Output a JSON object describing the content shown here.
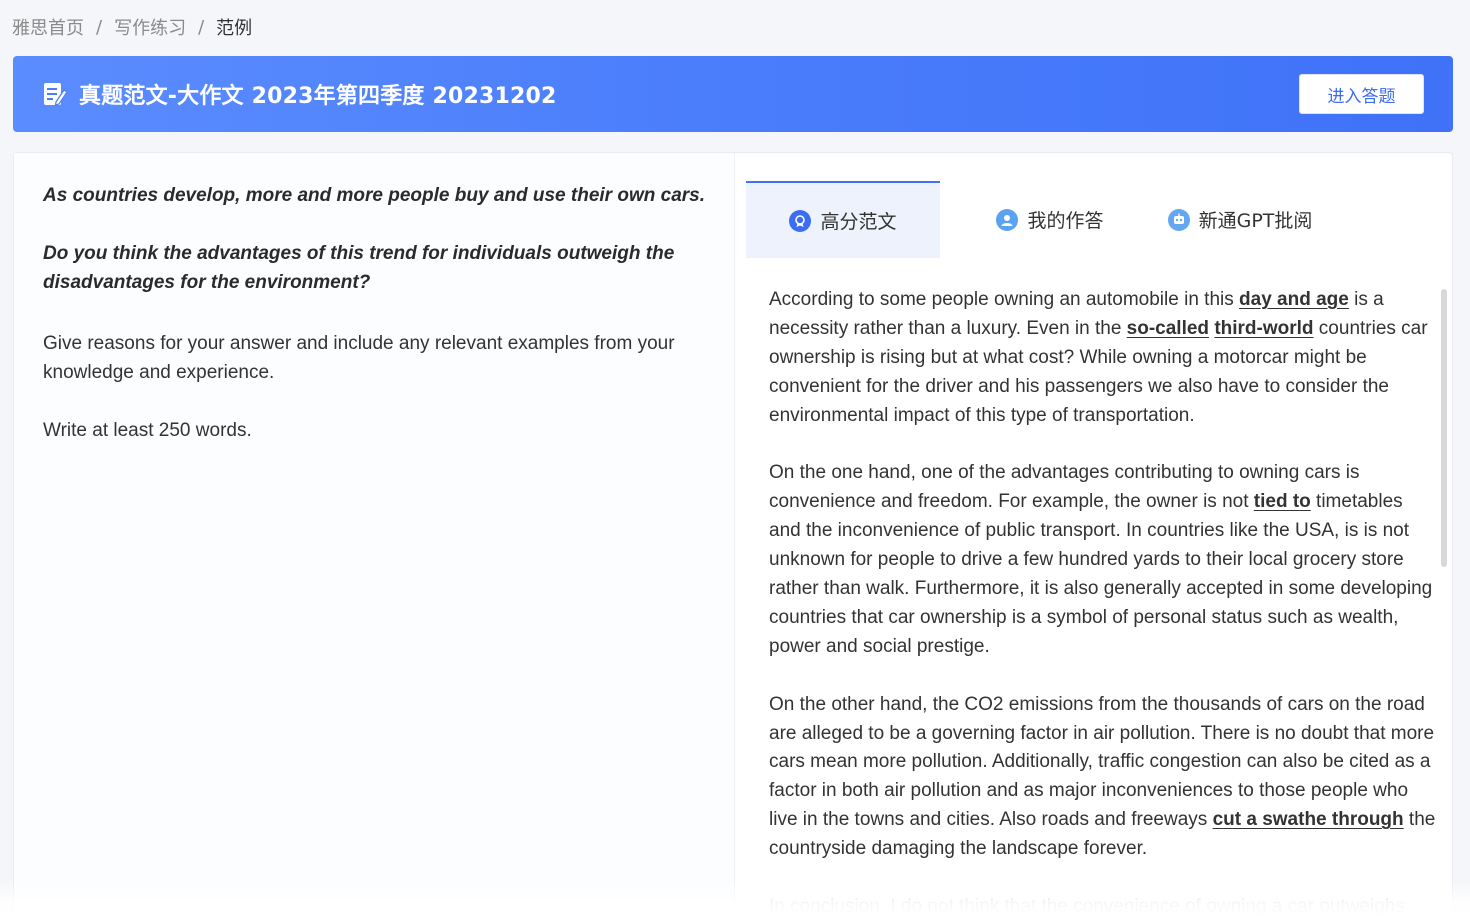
{
  "breadcrumb": {
    "items": [
      "雅思首页",
      "写作练习",
      "范例"
    ],
    "separator": "/"
  },
  "banner": {
    "icon": "edit-document-icon",
    "title": "真题范文-大作文 2023年第四季度 20231202",
    "enter_button": "进入答题"
  },
  "question": {
    "line1": "As countries develop, more and more people buy and use their own cars.",
    "line2": "Do you think the advantages of this trend for individuals outweigh the disadvantages for the environment?",
    "line3": "Give reasons for your answer and include any relevant examples from your knowledge and experience.",
    "line4": "Write at least 250 words."
  },
  "tabs": [
    {
      "label": "高分范文",
      "icon": "award-badge-icon",
      "active": true
    },
    {
      "label": "我的作答",
      "icon": "user-icon",
      "active": false
    },
    {
      "label": "新通GPT批阅",
      "icon": "robot-icon",
      "active": false
    }
  ],
  "essay": {
    "p1": {
      "a": "According to some people owning an automobile in this ",
      "u1": "day and age",
      "b": " is a necessity rather than a luxury. Even in the ",
      "u2": "so-called",
      "c": " ",
      "u3": "third-world",
      "d": " countries car ownership is rising but at what cost? While owning a motorcar might be convenient for the driver and his passengers we also have to consider the environmental impact of this type of transportation."
    },
    "p2": {
      "a": "On the one hand, one of the advantages contributing to owning cars is convenience and freedom. For example, the owner is not ",
      "u1": "tied to",
      "b": " timetables and the inconvenience of public transport. In countries like the USA, is is not unknown for people to drive a few hundred yards to their local grocery store rather than walk. Furthermore, it is also generally accepted in some  developing countries that car ownership is a symbol of personal status such as wealth, power and social prestige."
    },
    "p3": {
      "a": "On the other hand, the CO2 emissions from the thousands of cars on the road are alleged to be a governing factor in air pollution. There is no doubt that more cars mean more pollution.  Additionally, traffic congestion can also be cited as a factor in both air pollution and as major inconveniences to those people who live in the towns and cities. Also roads and freeways ",
      "u1": "cut a swathe through",
      "b": " the countryside damaging the landscape forever."
    },
    "p4": "In conclusion, I do not think that the convenience of owning a car outweighs"
  },
  "colors": {
    "accent": "#3f72f8",
    "banner_start": "#5b8cff",
    "tab_active_bg": "#edf2fd"
  }
}
